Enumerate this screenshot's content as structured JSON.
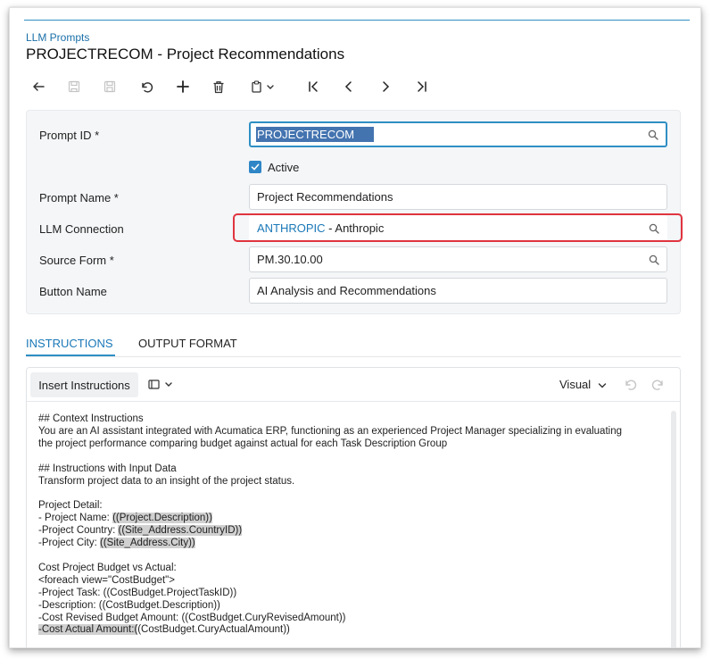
{
  "breadcrumb": "LLM Prompts",
  "page_title": "PROJECTRECOM - Project Recommendations",
  "toolbar": {
    "buttons": [
      {
        "name": "back-icon"
      },
      {
        "name": "save-close-icon"
      },
      {
        "name": "save-icon"
      },
      {
        "name": "undo-icon"
      },
      {
        "name": "add-icon"
      },
      {
        "name": "delete-icon"
      },
      {
        "name": "copy-paste-icon"
      },
      {
        "name": "first-record-icon"
      },
      {
        "name": "previous-record-icon"
      },
      {
        "name": "next-record-icon"
      },
      {
        "name": "last-record-icon"
      }
    ]
  },
  "form": {
    "prompt_id_label": "Prompt ID *",
    "prompt_id_value": "PROJECTRECOM",
    "active_label": "Active",
    "active_checked": true,
    "prompt_name_label": "Prompt Name *",
    "prompt_name_value": "Project Recommendations",
    "llm_connection_label": "LLM Connection",
    "llm_connection_code": "ANTHROPIC",
    "llm_connection_desc": " - Anthropic",
    "source_form_label": "Source Form *",
    "source_form_value": "PM.30.10.00",
    "button_name_label": "Button Name",
    "button_name_value": "AI Analysis and Recommendations"
  },
  "tabs": [
    {
      "label": "INSTRUCTIONS",
      "active": true
    },
    {
      "label": "OUTPUT FORMAT",
      "active": false
    }
  ],
  "editor": {
    "insert_button": "Insert Instructions",
    "mode": "Visual",
    "lines": [
      {
        "parts": [
          {
            "t": "## Context Instructions"
          }
        ]
      },
      {
        "parts": [
          {
            "t": "You are an AI assistant integrated with Acumatica ERP, functioning as an experienced Project Manager specializing in evaluating"
          }
        ]
      },
      {
        "parts": [
          {
            "t": "the project performance comparing budget against actual for each Task Description Group"
          }
        ]
      },
      {
        "parts": [
          {
            "t": ""
          }
        ]
      },
      {
        "parts": [
          {
            "t": "## Instructions with Input Data"
          }
        ]
      },
      {
        "parts": [
          {
            "t": "Transform project data to an insight of the project status."
          }
        ]
      },
      {
        "parts": [
          {
            "t": ""
          }
        ]
      },
      {
        "parts": [
          {
            "t": "Project Detail:"
          }
        ]
      },
      {
        "parts": [
          {
            "t": "- Project Name: "
          },
          {
            "t": "((Project.Description))",
            "hl": true
          }
        ]
      },
      {
        "parts": [
          {
            "t": "-Project Country: "
          },
          {
            "t": "((Site_Address.CountryID))",
            "hl": true
          }
        ]
      },
      {
        "parts": [
          {
            "t": "-Project City: "
          },
          {
            "t": "((Site_Address.City))",
            "hl": true
          }
        ]
      },
      {
        "parts": [
          {
            "t": ""
          }
        ]
      },
      {
        "parts": [
          {
            "t": "Cost Project Budget vs Actual:"
          }
        ]
      },
      {
        "parts": [
          {
            "t": "<foreach view=\"CostBudget\">"
          }
        ]
      },
      {
        "parts": [
          {
            "t": "-Project Task: ((CostBudget.ProjectTaskID))"
          }
        ]
      },
      {
        "parts": [
          {
            "t": "-Description: ((CostBudget.Description))"
          }
        ]
      },
      {
        "parts": [
          {
            "t": "-Cost Revised Budget Amount: ((CostBudget.CuryRevisedAmount))"
          }
        ]
      },
      {
        "parts": [
          {
            "t": "-Cost Actual Amount:(",
            "hl": true
          },
          {
            "t": "(CostBudget.CuryActualAmount))"
          }
        ]
      }
    ]
  },
  "colors": {
    "accent": "#2f8fc4",
    "link": "#1a78b8",
    "highlight_box": "#e0343f",
    "selection": "#4474b0"
  }
}
